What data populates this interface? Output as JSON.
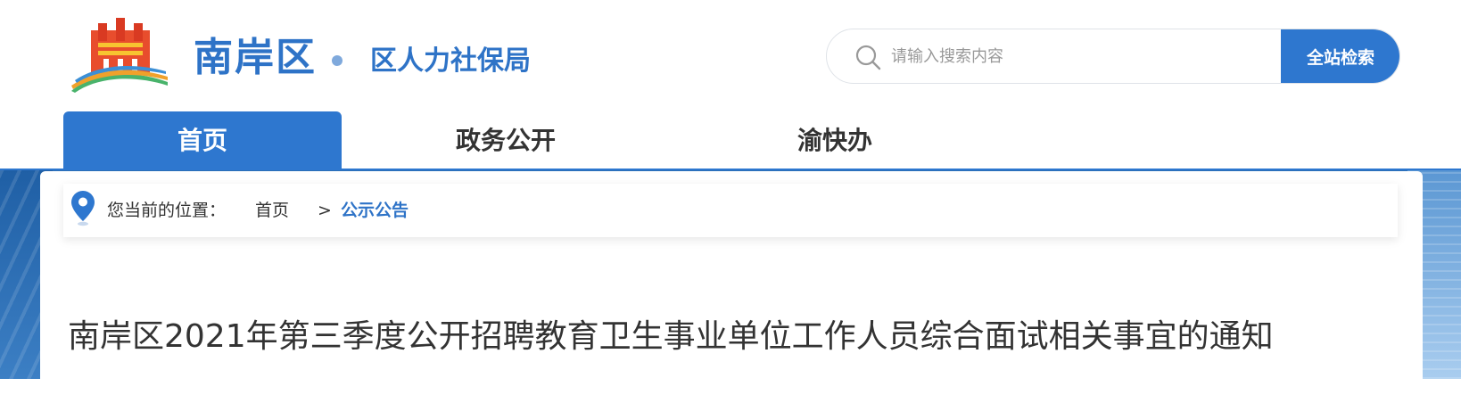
{
  "header": {
    "site_name": "南岸区",
    "department": "区人力社保局",
    "logo_icon": "city-gate-logo-icon"
  },
  "search": {
    "placeholder": "请输入搜索内容",
    "value": "",
    "button_label": "全站检索",
    "icon": "search-icon"
  },
  "nav": {
    "items": [
      {
        "label": "首页",
        "active": true
      },
      {
        "label": "政务公开",
        "active": false
      },
      {
        "label": "渝快办",
        "active": false
      }
    ]
  },
  "breadcrumb": {
    "prefix": "您当前的位置：",
    "home": "首页",
    "separator": ">",
    "current": "公示公告",
    "icon": "location-pin-icon"
  },
  "article": {
    "title": "南岸区2021年第三季度公开招聘教育卫生事业单位工作人员综合面试相关事宜的通知"
  },
  "colors": {
    "brand_blue": "#2e77cf",
    "title_blue": "#2e73c7",
    "text_dark": "#333333"
  }
}
